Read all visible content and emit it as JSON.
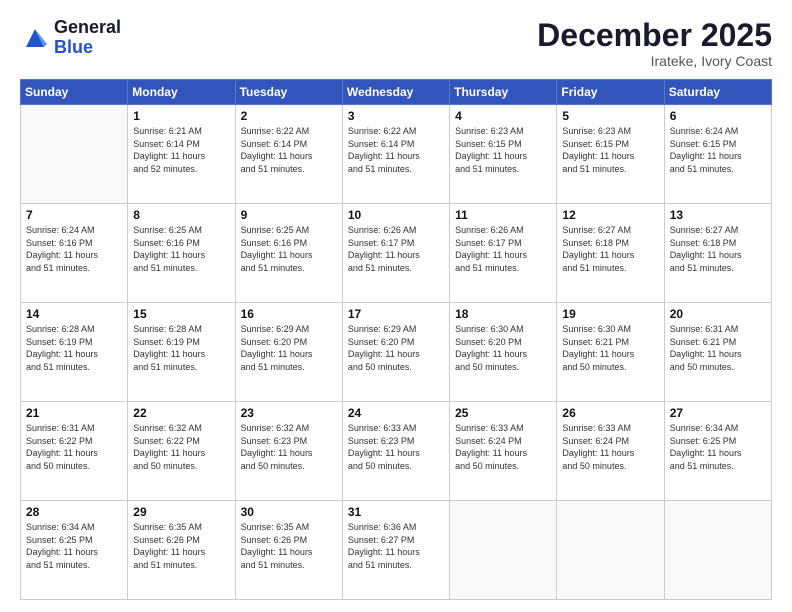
{
  "header": {
    "logo_line1": "General",
    "logo_line2": "Blue",
    "month_title": "December 2025",
    "location": "Irateke, Ivory Coast"
  },
  "days_of_week": [
    "Sunday",
    "Monday",
    "Tuesday",
    "Wednesday",
    "Thursday",
    "Friday",
    "Saturday"
  ],
  "weeks": [
    [
      {
        "day": "",
        "info": ""
      },
      {
        "day": "1",
        "info": "Sunrise: 6:21 AM\nSunset: 6:14 PM\nDaylight: 11 hours\nand 52 minutes."
      },
      {
        "day": "2",
        "info": "Sunrise: 6:22 AM\nSunset: 6:14 PM\nDaylight: 11 hours\nand 51 minutes."
      },
      {
        "day": "3",
        "info": "Sunrise: 6:22 AM\nSunset: 6:14 PM\nDaylight: 11 hours\nand 51 minutes."
      },
      {
        "day": "4",
        "info": "Sunrise: 6:23 AM\nSunset: 6:15 PM\nDaylight: 11 hours\nand 51 minutes."
      },
      {
        "day": "5",
        "info": "Sunrise: 6:23 AM\nSunset: 6:15 PM\nDaylight: 11 hours\nand 51 minutes."
      },
      {
        "day": "6",
        "info": "Sunrise: 6:24 AM\nSunset: 6:15 PM\nDaylight: 11 hours\nand 51 minutes."
      }
    ],
    [
      {
        "day": "7",
        "info": "Sunrise: 6:24 AM\nSunset: 6:16 PM\nDaylight: 11 hours\nand 51 minutes."
      },
      {
        "day": "8",
        "info": "Sunrise: 6:25 AM\nSunset: 6:16 PM\nDaylight: 11 hours\nand 51 minutes."
      },
      {
        "day": "9",
        "info": "Sunrise: 6:25 AM\nSunset: 6:16 PM\nDaylight: 11 hours\nand 51 minutes."
      },
      {
        "day": "10",
        "info": "Sunrise: 6:26 AM\nSunset: 6:17 PM\nDaylight: 11 hours\nand 51 minutes."
      },
      {
        "day": "11",
        "info": "Sunrise: 6:26 AM\nSunset: 6:17 PM\nDaylight: 11 hours\nand 51 minutes."
      },
      {
        "day": "12",
        "info": "Sunrise: 6:27 AM\nSunset: 6:18 PM\nDaylight: 11 hours\nand 51 minutes."
      },
      {
        "day": "13",
        "info": "Sunrise: 6:27 AM\nSunset: 6:18 PM\nDaylight: 11 hours\nand 51 minutes."
      }
    ],
    [
      {
        "day": "14",
        "info": "Sunrise: 6:28 AM\nSunset: 6:19 PM\nDaylight: 11 hours\nand 51 minutes."
      },
      {
        "day": "15",
        "info": "Sunrise: 6:28 AM\nSunset: 6:19 PM\nDaylight: 11 hours\nand 51 minutes."
      },
      {
        "day": "16",
        "info": "Sunrise: 6:29 AM\nSunset: 6:20 PM\nDaylight: 11 hours\nand 51 minutes."
      },
      {
        "day": "17",
        "info": "Sunrise: 6:29 AM\nSunset: 6:20 PM\nDaylight: 11 hours\nand 50 minutes."
      },
      {
        "day": "18",
        "info": "Sunrise: 6:30 AM\nSunset: 6:20 PM\nDaylight: 11 hours\nand 50 minutes."
      },
      {
        "day": "19",
        "info": "Sunrise: 6:30 AM\nSunset: 6:21 PM\nDaylight: 11 hours\nand 50 minutes."
      },
      {
        "day": "20",
        "info": "Sunrise: 6:31 AM\nSunset: 6:21 PM\nDaylight: 11 hours\nand 50 minutes."
      }
    ],
    [
      {
        "day": "21",
        "info": "Sunrise: 6:31 AM\nSunset: 6:22 PM\nDaylight: 11 hours\nand 50 minutes."
      },
      {
        "day": "22",
        "info": "Sunrise: 6:32 AM\nSunset: 6:22 PM\nDaylight: 11 hours\nand 50 minutes."
      },
      {
        "day": "23",
        "info": "Sunrise: 6:32 AM\nSunset: 6:23 PM\nDaylight: 11 hours\nand 50 minutes."
      },
      {
        "day": "24",
        "info": "Sunrise: 6:33 AM\nSunset: 6:23 PM\nDaylight: 11 hours\nand 50 minutes."
      },
      {
        "day": "25",
        "info": "Sunrise: 6:33 AM\nSunset: 6:24 PM\nDaylight: 11 hours\nand 50 minutes."
      },
      {
        "day": "26",
        "info": "Sunrise: 6:33 AM\nSunset: 6:24 PM\nDaylight: 11 hours\nand 50 minutes."
      },
      {
        "day": "27",
        "info": "Sunrise: 6:34 AM\nSunset: 6:25 PM\nDaylight: 11 hours\nand 51 minutes."
      }
    ],
    [
      {
        "day": "28",
        "info": "Sunrise: 6:34 AM\nSunset: 6:25 PM\nDaylight: 11 hours\nand 51 minutes."
      },
      {
        "day": "29",
        "info": "Sunrise: 6:35 AM\nSunset: 6:26 PM\nDaylight: 11 hours\nand 51 minutes."
      },
      {
        "day": "30",
        "info": "Sunrise: 6:35 AM\nSunset: 6:26 PM\nDaylight: 11 hours\nand 51 minutes."
      },
      {
        "day": "31",
        "info": "Sunrise: 6:36 AM\nSunset: 6:27 PM\nDaylight: 11 hours\nand 51 minutes."
      },
      {
        "day": "",
        "info": ""
      },
      {
        "day": "",
        "info": ""
      },
      {
        "day": "",
        "info": ""
      }
    ]
  ]
}
